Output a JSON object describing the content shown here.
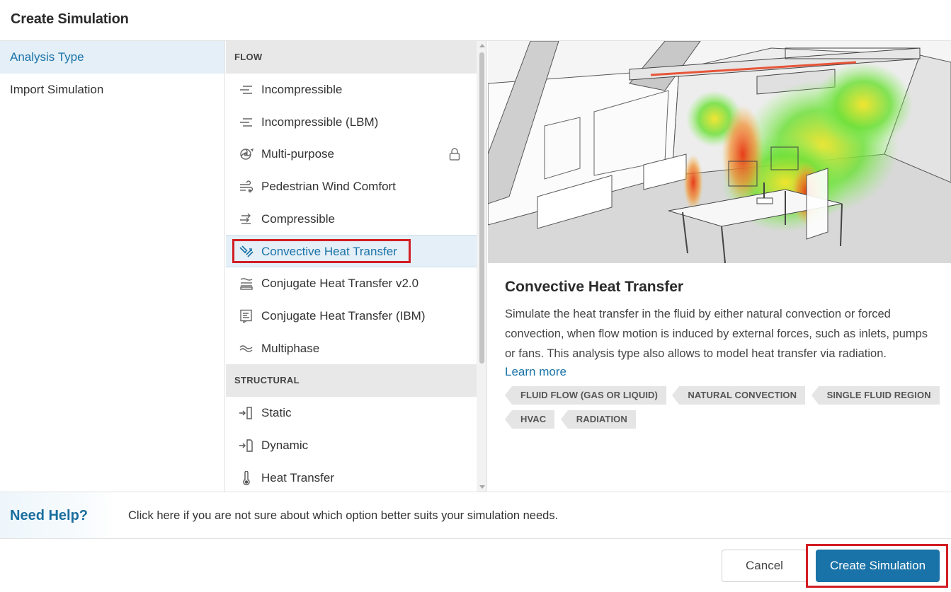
{
  "dialog": {
    "title": "Create Simulation"
  },
  "left_nav": {
    "items": [
      {
        "label": "Analysis Type",
        "active": true
      },
      {
        "label": "Import Simulation",
        "active": false
      }
    ]
  },
  "categories": [
    {
      "header": "FLOW",
      "items": [
        {
          "label": "Incompressible",
          "icon": "flow-lines-icon"
        },
        {
          "label": "Incompressible (LBM)",
          "icon": "flow-lines-icon"
        },
        {
          "label": "Multi-purpose",
          "icon": "fan-icon",
          "locked": true
        },
        {
          "label": "Pedestrian Wind Comfort",
          "icon": "wind-icon"
        },
        {
          "label": "Compressible",
          "icon": "compressible-arrows-icon"
        },
        {
          "label": "Convective Heat Transfer",
          "icon": "convective-arrows-icon",
          "active": true
        },
        {
          "label": "Conjugate Heat Transfer v2.0",
          "icon": "layers-icon"
        },
        {
          "label": "Conjugate Heat Transfer (IBM)",
          "icon": "document-icon"
        },
        {
          "label": "Multiphase",
          "icon": "waves-icon"
        }
      ]
    },
    {
      "header": "STRUCTURAL",
      "items": [
        {
          "label": "Static",
          "icon": "static-load-icon"
        },
        {
          "label": "Dynamic",
          "icon": "dynamic-load-icon"
        },
        {
          "label": "Heat Transfer",
          "icon": "thermometer-icon"
        }
      ]
    }
  ],
  "detail": {
    "title": "Convective Heat Transfer",
    "description": "Simulate the heat transfer in the fluid by either natural convection or forced convection, when flow motion is induced by external forces, such as inlets, pumps or fans. This analysis type also allows to model heat transfer via radiation.",
    "learn_more": "Learn more",
    "tags": [
      "FLUID FLOW (GAS OR LIQUID)",
      "NATURAL CONVECTION",
      "SINGLE FLUID REGION",
      "HVAC",
      "RADIATION"
    ]
  },
  "help": {
    "title": "Need Help?",
    "text": "Click here if you are not sure about which option better suits your simulation needs."
  },
  "footer": {
    "cancel_label": "Cancel",
    "create_label": "Create Simulation"
  },
  "colors": {
    "accent": "#1a73a8",
    "highlight_red": "#d21d24",
    "active_bg": "#e4eff7"
  }
}
